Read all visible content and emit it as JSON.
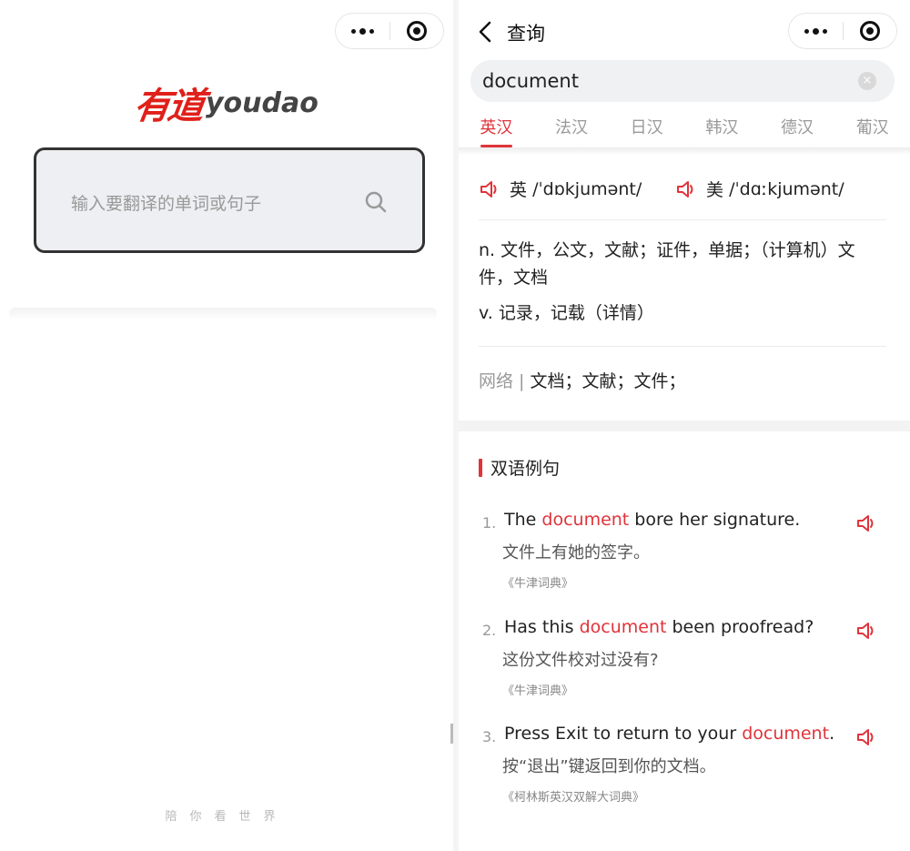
{
  "left_panel": {
    "logo_cn": "有道",
    "logo_en": "youdao",
    "search_placeholder": "输入要翻译的单词或句子",
    "slogan": "陪你看世界",
    "icons": [
      "more-dots-icon",
      "close-target-icon",
      "search-icon"
    ]
  },
  "right_panel": {
    "nav_title": "查询",
    "query": "document",
    "clear_icon": "×",
    "tabs": [
      "英汉",
      "法汉",
      "日汉",
      "韩汉",
      "德汉",
      "葡汉"
    ],
    "active_tab": "英汉",
    "phonetics": [
      {
        "region": "英",
        "ipa": "/ˈdɒkjumənt/"
      },
      {
        "region": "美",
        "ipa": "/ˈdɑːkjumənt/"
      }
    ],
    "definitions": [
      "n. 文件，公文，文献；证件，单据；（计算机）文件，文档",
      "v. 记录，记载（详情）"
    ],
    "web_label": "网络 |",
    "web_definition": "文档；文献；文件；",
    "section_title": "双语例句",
    "examples": [
      {
        "num": "1.",
        "before": "The ",
        "highlight": "document",
        "after": " bore her signature.",
        "zh": "文件上有她的签字。",
        "source": "《牛津词典》"
      },
      {
        "num": "2.",
        "before": "Has this ",
        "highlight": "document",
        "after": " been proofread?",
        "zh": "这份文件校对过没有?",
        "source": "《牛津词典》"
      },
      {
        "num": "3.",
        "before": "Press Exit to return to your ",
        "highlight": "document",
        "after": ".",
        "zh": "按“退出”键返回到你的文档。",
        "source": "《柯林斯英汉双解大词典》"
      }
    ]
  },
  "colors": {
    "accent": "#e0333a",
    "brand_red": "#e0201b"
  }
}
